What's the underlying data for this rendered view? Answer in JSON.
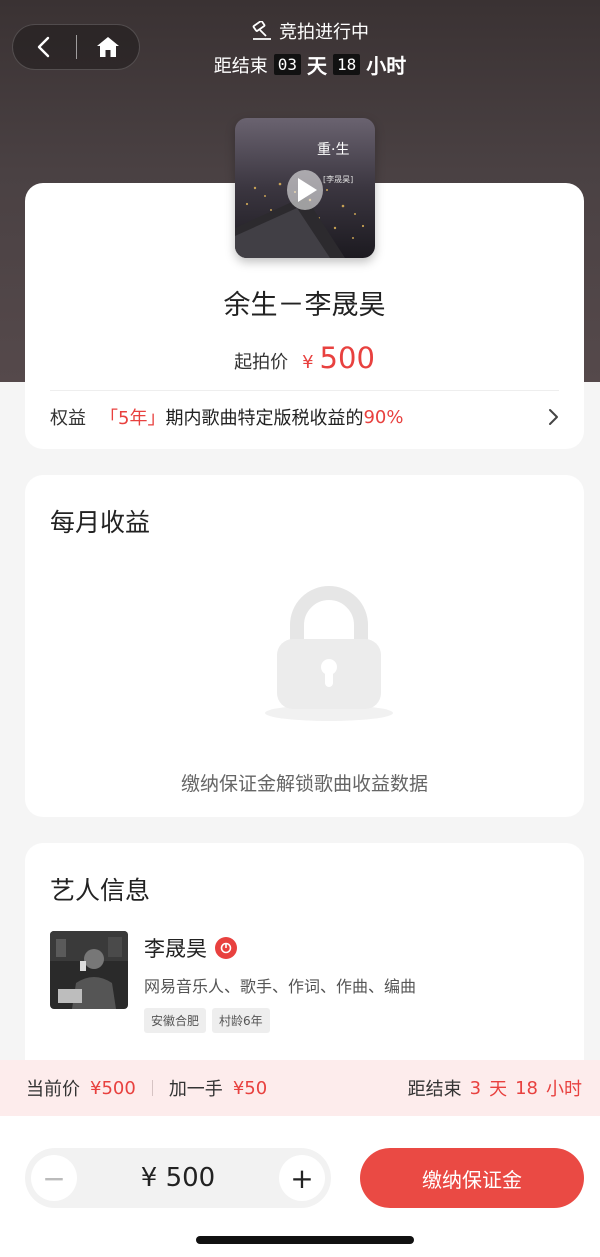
{
  "header": {
    "status_title": "竞拍进行中",
    "countdown_prefix": "距结束",
    "days_value": "03",
    "days_unit": "天",
    "hours_value": "18",
    "hours_unit": "小时"
  },
  "icons": {
    "back": "back-chevron-icon",
    "home": "home-icon",
    "gavel": "gavel-icon",
    "play": "play-icon",
    "lock": "lock-icon",
    "verified": "verified-badge-icon",
    "chevron": "chevron-right-icon"
  },
  "song": {
    "cover_title": "重·生",
    "cover_artist": "李晟昊",
    "title": "余生－李晟昊",
    "start_price_label": "起拍价",
    "currency": "¥",
    "start_price": "500"
  },
  "rights": {
    "label": "权益",
    "period": "「5年」",
    "text": "期内歌曲特定版税收益的",
    "percent": "90%"
  },
  "monthly_revenue": {
    "title": "每月收益",
    "locked_text": "缴纳保证金解锁歌曲收益数据"
  },
  "artist": {
    "section_title": "艺人信息",
    "name": "李晟昊",
    "roles": "网易音乐人、歌手、作词、作曲、编曲",
    "tags": [
      "安徽合肥",
      "村龄6年"
    ]
  },
  "bid_bar": {
    "current_label": "当前价",
    "current_value": "¥500",
    "increment_label": "加一手",
    "increment_value": "¥50",
    "end_label": "距结束",
    "days": "3",
    "days_unit": "天",
    "hours": "18",
    "hours_unit": "小时"
  },
  "bottom": {
    "minus_label": "−",
    "plus_label": "+",
    "amount": "¥ 500",
    "pay_button": "缴纳保证金"
  },
  "colors": {
    "accent": "#e8413f",
    "button": "#ea4a44",
    "bid_bar_bg": "#fdecec"
  }
}
